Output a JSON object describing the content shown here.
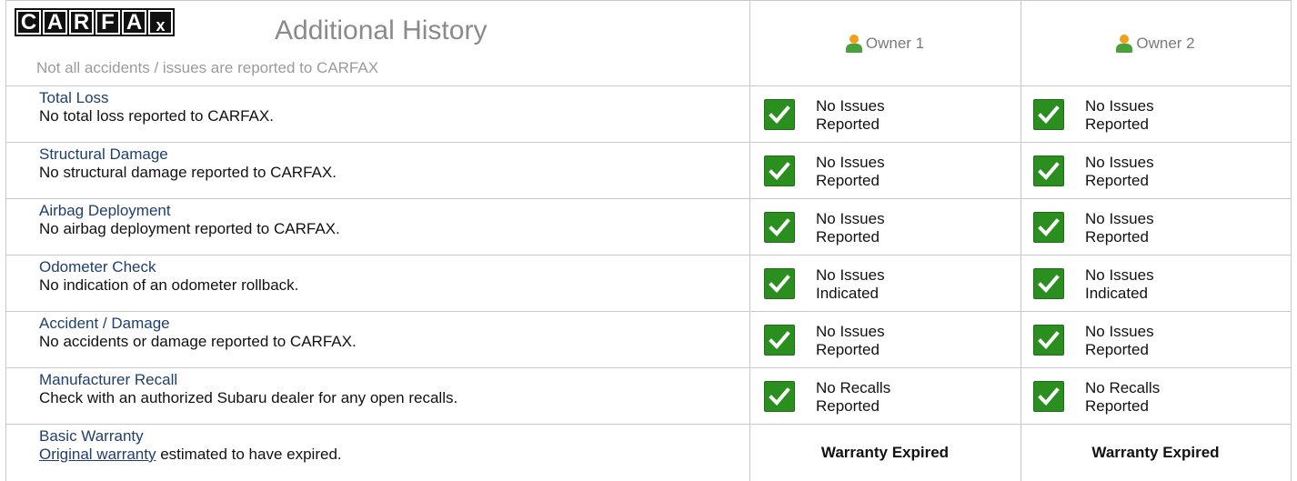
{
  "header": {
    "logo_letters": [
      "C",
      "A",
      "R",
      "F",
      "A",
      "x"
    ],
    "title": "Additional History",
    "subtitle": "Not all accidents / issues are reported to CARFAX",
    "owners": [
      "Owner 1",
      "Owner 2"
    ]
  },
  "rows": [
    {
      "title": "Total Loss",
      "desc": "No total loss reported to CARFAX.",
      "status": [
        [
          "No Issues",
          "Reported"
        ],
        [
          "No Issues",
          "Reported"
        ]
      ]
    },
    {
      "title": "Structural Damage",
      "desc": "No structural damage reported to CARFAX.",
      "status": [
        [
          "No Issues",
          "Reported"
        ],
        [
          "No Issues",
          "Reported"
        ]
      ]
    },
    {
      "title": "Airbag Deployment",
      "desc": "No airbag deployment reported to CARFAX.",
      "status": [
        [
          "No Issues",
          "Reported"
        ],
        [
          "No Issues",
          "Reported"
        ]
      ]
    },
    {
      "title": "Odometer Check",
      "desc": "No indication of an odometer rollback.",
      "status": [
        [
          "No Issues",
          "Indicated"
        ],
        [
          "No Issues",
          "Indicated"
        ]
      ]
    },
    {
      "title": "Accident / Damage",
      "desc": "No accidents or damage reported to CARFAX.",
      "status": [
        [
          "No Issues",
          "Reported"
        ],
        [
          "No Issues",
          "Reported"
        ]
      ]
    },
    {
      "title": "Manufacturer Recall",
      "desc": "Check with an authorized Subaru dealer for any open recalls.",
      "status": [
        [
          "No Recalls",
          "Reported"
        ],
        [
          "No Recalls",
          "Reported"
        ]
      ]
    }
  ],
  "warranty_row": {
    "title": "Basic Warranty",
    "link_text": "Original warranty",
    "desc_rest": " estimated to have expired.",
    "status": [
      "Warranty Expired",
      "Warranty Expired"
    ]
  },
  "icons": {
    "check": "check-icon",
    "owner": "person-icon"
  },
  "colors": {
    "check_green": "#2a8f1f",
    "link_blue": "#1f3f6e",
    "title_gray": "#8a8a8a"
  }
}
